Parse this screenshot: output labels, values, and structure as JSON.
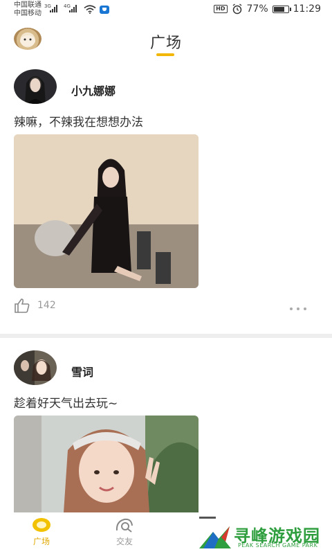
{
  "status_bar": {
    "carrier_1": "中国联通",
    "carrier_2": "中国移动",
    "net_1": "3G",
    "net_2": "4G",
    "hd": "HD",
    "battery": "77%",
    "battery_level": 0.77,
    "time": "11:29"
  },
  "header": {
    "title": "广场"
  },
  "posts": [
    {
      "username": "小九娜娜",
      "text": "辣嘛，不辣我在想想办法",
      "likes": "142"
    },
    {
      "username": "雪词",
      "text": "趁着好天气出去玩~"
    }
  ],
  "tabbar": {
    "tabs": [
      {
        "label": "广场"
      },
      {
        "label": "交友"
      }
    ]
  },
  "watermark": {
    "text": "寻峰游戏园",
    "sub": "PEAK SEARCH GAME PARK"
  },
  "colors": {
    "accent": "#f2b705",
    "watermark": "#2e9e3e"
  }
}
